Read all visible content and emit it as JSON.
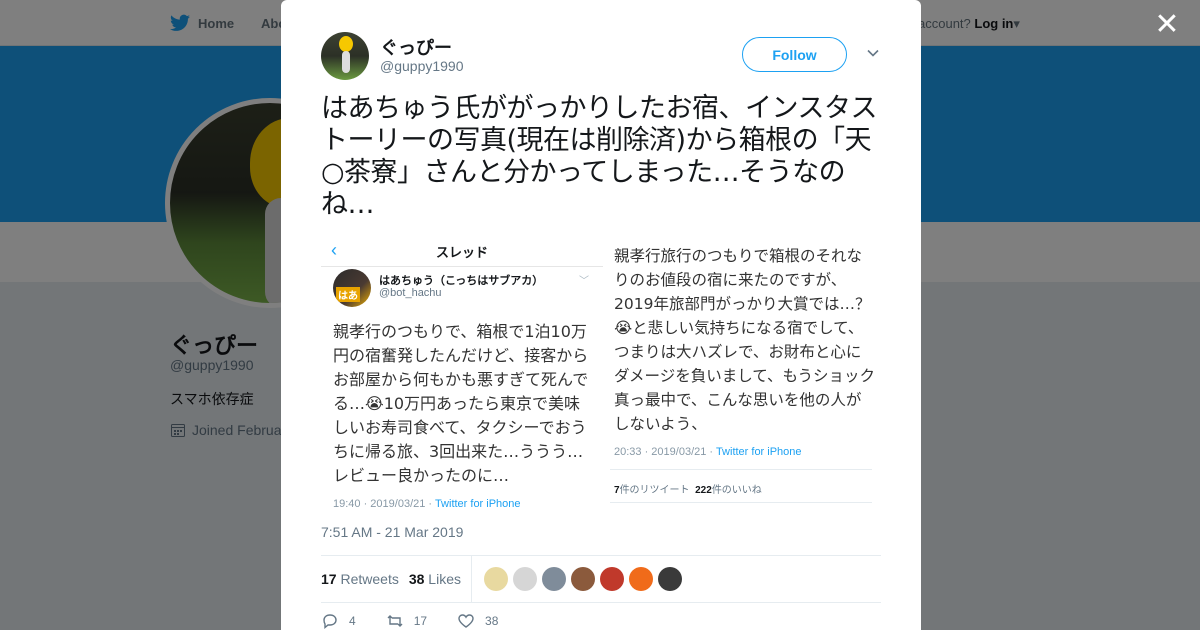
{
  "nav": {
    "home_label": "Home",
    "about_label": "Abo",
    "account_prompt": "account?",
    "login_label": "Log in"
  },
  "profile": {
    "name": "ぐっぴー",
    "handle": "@guppy1990",
    "bio": "スマホ依存症",
    "joined": "Joined Februa"
  },
  "tweet": {
    "author_name": "ぐっぴー",
    "author_handle": "@guppy1990",
    "follow_label": "Follow",
    "text": "はあちゅう氏ががっかりしたお宿、インスタストーリーの写真(現在は削除済)から箱根の「天○茶寮」さんと分かってしまった…そうなのね…",
    "timestamp": "7:51 AM - 21 Mar 2019",
    "retweets_count": "17",
    "retweets_label": "Retweets",
    "likes_count": "38",
    "likes_label": "Likes",
    "actions": {
      "reply_count": "4",
      "retweet_count": "17",
      "like_count": "38"
    },
    "liker_colors": [
      "#e8d9a0",
      "#d6d6d6",
      "#7f8c9a",
      "#8b5a3c",
      "#c0392b",
      "#f06b1a",
      "#3a3a3a"
    ]
  },
  "embedded_left": {
    "back_glyph": "‹",
    "header_title": "スレッド",
    "avatar_badge": "はあ",
    "user_name": "はあちゅう（こっちはサブアカ）",
    "user_handle": "@bot_hachu",
    "body": "親孝行のつもりで、箱根で1泊10万円の宿奮発したんだけど、接客からお部屋から何もかも悪すぎて死んでる…😭10万円あったら東京で美味しいお寿司食べて、タクシーでおうちに帰る旅、3回出来た…ううう…レビュー良かったのに…",
    "meta_time": "19:40 · 2019/03/21 · ",
    "meta_source": "Twitter for iPhone"
  },
  "embedded_right": {
    "body": "親孝行旅行のつもりで箱根のそれなりのお値段の宿に来たのですが、2019年旅部門がっかり大賞では…？😭と悲しい気持ちになる宿でして、つまりは大ハズレで、お財布と心にダメージを負いまして、もうショック真っ最中で、こんな思いを他の人がしないよう、",
    "meta_time": "20:33 · 2019/03/21 · ",
    "meta_source": "Twitter for iPhone",
    "retweets_num": "7",
    "retweets_text": "件のリツイート",
    "likes_num": "222",
    "likes_text": "件のいいね"
  },
  "colors": {
    "accent": "#1da1f2",
    "banner": "#1da1f2"
  }
}
